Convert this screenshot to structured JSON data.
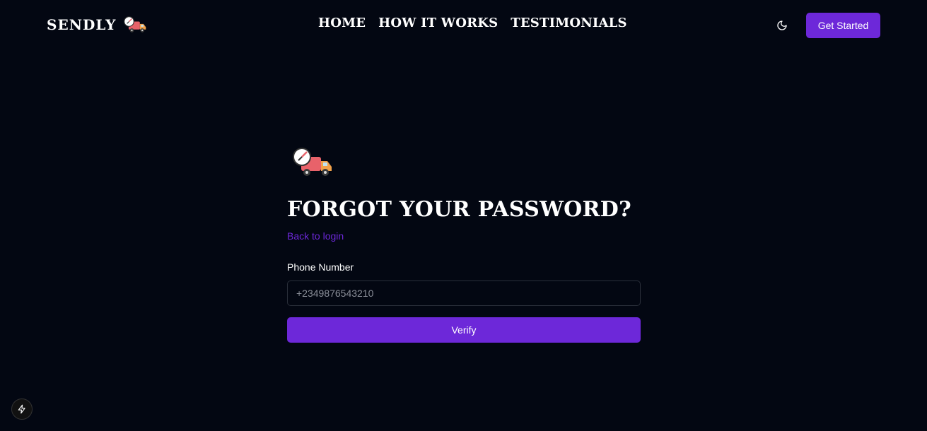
{
  "header": {
    "brand": "SENDLY",
    "nav": [
      "HOME",
      "HOW IT WORKS",
      "TESTIMONIALS"
    ],
    "theme_icon": "moon-icon",
    "cta_label": "Get Started"
  },
  "form": {
    "logo_icon": "delivery-truck-clock-icon",
    "title": "FORGOT YOUR PASSWORD?",
    "back_link": "Back to login",
    "phone_label": "Phone Number",
    "phone_placeholder": "+2349876543210",
    "phone_value": "",
    "submit_label": "Verify"
  },
  "colors": {
    "background": "#030712",
    "accent": "#6d28d9",
    "text": "#ffffff"
  },
  "dev_indicator_icon": "lightning-icon"
}
